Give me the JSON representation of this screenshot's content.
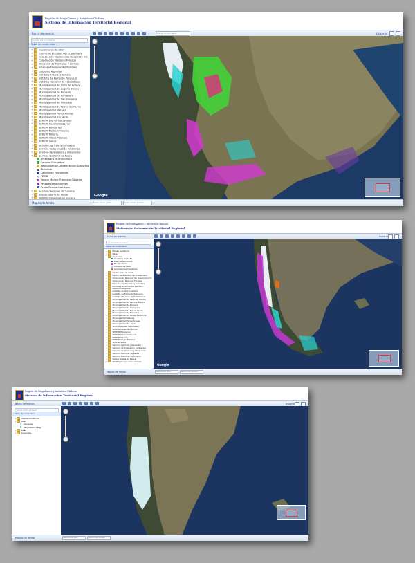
{
  "app": {
    "header_line1": "Región de Magallanes y Antártica Chilena",
    "header_line2": "Sistema de Información Territorial Regional"
  },
  "ui": {
    "panel_title": "Barra de menús",
    "search_placeholder": "Ingrese texto a buscar",
    "layers_tab": "Tabla de contenidos",
    "user_label": "Usuario",
    "status_label": "Mapas de fondo",
    "status_field1": "Seleccionar gobi",
    "status_field2": "Seleccionar ámbito",
    "map_credit": "Google",
    "search_box": "Buscar en el mapa..."
  },
  "screen1": {
    "layers": [
      {
        "label": "Carabineros de Chile",
        "kind": "folder"
      },
      {
        "label": "Centro de Estudios del Cuaternario",
        "kind": "folder"
      },
      {
        "label": "Corporación Nacional de Desarrollo Ind.",
        "kind": "folder"
      },
      {
        "label": "Corporación Nacional Forestal",
        "kind": "folder"
      },
      {
        "label": "Dirección de Fronteras y Límites",
        "kind": "folder"
      },
      {
        "label": "Empresa Nacional del Petróleo",
        "kind": "folder"
      },
      {
        "label": "Gobierno Regional",
        "kind": "folder"
      },
      {
        "label": "Instituto Antártico Chileno",
        "kind": "folder"
      },
      {
        "label": "Instituto de Fomento Pesquero",
        "kind": "folder"
      },
      {
        "label": "Instituto Nacional de Estadísticas",
        "kind": "folder"
      },
      {
        "label": "Municipalidad de Cabo de Hornos",
        "kind": "folder"
      },
      {
        "label": "Municipalidad de Laguna Blanca",
        "kind": "folder"
      },
      {
        "label": "Municipalidad de Porvenir",
        "kind": "folder"
      },
      {
        "label": "Municipalidad de Primavera",
        "kind": "folder"
      },
      {
        "label": "Municipalidad de San Gregorio",
        "kind": "folder"
      },
      {
        "label": "Municipalidad de Timaukel",
        "kind": "folder"
      },
      {
        "label": "Municipalidad de Torres del Payne",
        "kind": "folder"
      },
      {
        "label": "Municipalidad Natales",
        "kind": "folder"
      },
      {
        "label": "Municipalidad Punta Arenas",
        "kind": "folder"
      },
      {
        "label": "Municipalidad Río Verde",
        "kind": "folder"
      },
      {
        "label": "SEREMI Bienes Nacionales",
        "kind": "folder"
      },
      {
        "label": "SEREMI Desarrollo Social",
        "kind": "folder"
      },
      {
        "label": "SEREMI Educación",
        "kind": "folder"
      },
      {
        "label": "SEREMI Medio Ambiente",
        "kind": "folder"
      },
      {
        "label": "SEREMI Minería",
        "kind": "folder"
      },
      {
        "label": "SEREMI Obras Públicas",
        "kind": "folder"
      },
      {
        "label": "SEREMI Salud",
        "kind": "folder"
      },
      {
        "label": "Servicio Agrícola y Ganadero",
        "kind": "folder"
      },
      {
        "label": "Servicio de Evaluación Ambiental",
        "kind": "folder"
      },
      {
        "label": "Servicio de Vivienda y Urbanismo",
        "kind": "folder"
      },
      {
        "label": "Servicio Nacional de Pesca",
        "kind": "folder"
      },
      {
        "label": "Áreas para la Acuicultura",
        "kind": "layer",
        "color": "#3cb043"
      },
      {
        "label": "Centros Otorgados",
        "kind": "layer",
        "color": "#2a9d2a"
      },
      {
        "label": "Relocalización Desafectación Disturbio",
        "kind": "layer",
        "color": "#d9b300"
      },
      {
        "label": "Disturbio",
        "kind": "layer",
        "color": "#555555"
      },
      {
        "label": "Caletas de Pescadores",
        "kind": "layer",
        "color": "#1c2f8c"
      },
      {
        "label": "PDMB",
        "kind": "layer",
        "color": "#cccccc"
      },
      {
        "label": "Parque Marino Francisco Coloane",
        "kind": "layer",
        "color": "#c036c0"
      },
      {
        "label": "Pesca Recreativa Ríos",
        "kind": "layer",
        "color": "#7b2fbf"
      },
      {
        "label": "Pesca Recreativa Lagos",
        "kind": "layer",
        "color": "#2f5fbf"
      },
      {
        "label": "Servicio Nacional de Turismo",
        "kind": "folder"
      },
      {
        "label": "Subsecretaría de Pesca",
        "kind": "folder"
      },
      {
        "label": "Wildlife Conservation Society",
        "kind": "folder"
      }
    ]
  },
  "screen2": {
    "layers": [
      {
        "label": "Mapas temáticos",
        "kind": "folder"
      },
      {
        "label": "Base",
        "kind": "folder"
      },
      {
        "label": "Leyendas",
        "kind": "folder"
      },
      {
        "label": "Ciudades de Chile",
        "kind": "layer",
        "color": "#2a9d2a"
      },
      {
        "label": "Puertos Marítimos",
        "kind": "layer",
        "color": "#3b5bbf"
      },
      {
        "label": "Fondeaderos",
        "kind": "layer",
        "color": "#cc44cc"
      },
      {
        "label": "Campos de Hielo",
        "kind": "layer",
        "color": "#b0d8ff"
      },
      {
        "label": "Concesiones marítimas",
        "kind": "layer",
        "color": "#e06020"
      },
      {
        "label": "Carabineros de Chile",
        "kind": "folder"
      },
      {
        "label": "Centro de Estudios del Cuaternario",
        "kind": "folder"
      },
      {
        "label": "Corporación Nacional de Desarrollo Ind.",
        "kind": "folder"
      },
      {
        "label": "Corporación Nacional Forestal",
        "kind": "folder"
      },
      {
        "label": "Dirección de Fronteras y Límites",
        "kind": "folder"
      },
      {
        "label": "Empresa Nacional del Petróleo",
        "kind": "folder"
      },
      {
        "label": "Gobierno Regional",
        "kind": "folder"
      },
      {
        "label": "Instituto Antártico Chileno",
        "kind": "folder"
      },
      {
        "label": "Instituto de Fomento Pesquero",
        "kind": "folder"
      },
      {
        "label": "Instituto Nacional de Estadísticas",
        "kind": "folder"
      },
      {
        "label": "Municipalidad de Cabo de Hornos",
        "kind": "folder"
      },
      {
        "label": "Municipalidad de Laguna Blanca",
        "kind": "folder"
      },
      {
        "label": "Municipalidad de Porvenir",
        "kind": "folder"
      },
      {
        "label": "Municipalidad de Primavera",
        "kind": "folder"
      },
      {
        "label": "Municipalidad de San Gregorio",
        "kind": "folder"
      },
      {
        "label": "Municipalidad de Timaukel",
        "kind": "folder"
      },
      {
        "label": "Municipalidad de Torres del Payne",
        "kind": "folder"
      },
      {
        "label": "Municipalidad Natales",
        "kind": "folder"
      },
      {
        "label": "Municipalidad Punta Arenas",
        "kind": "folder"
      },
      {
        "label": "Municipalidad Río Verde",
        "kind": "folder"
      },
      {
        "label": "SEREMI Bienes Nacionales",
        "kind": "folder"
      },
      {
        "label": "SEREMI Desarrollo Social",
        "kind": "folder"
      },
      {
        "label": "SEREMI Educación",
        "kind": "folder"
      },
      {
        "label": "SEREMI Medio Ambiente",
        "kind": "folder"
      },
      {
        "label": "SEREMI Minería",
        "kind": "folder"
      },
      {
        "label": "SEREMI Obras Públicas",
        "kind": "folder"
      },
      {
        "label": "SEREMI Salud",
        "kind": "folder"
      },
      {
        "label": "Servicio Agrícola y Ganadero",
        "kind": "folder"
      },
      {
        "label": "Servicio de Evaluación Ambiental",
        "kind": "folder"
      },
      {
        "label": "Servicio de Vivienda y Urbanismo",
        "kind": "folder"
      },
      {
        "label": "Servicio Nacional de Pesca",
        "kind": "folder"
      },
      {
        "label": "Servicio Nacional de Turismo",
        "kind": "folder"
      },
      {
        "label": "Subsecretaría de Pesca",
        "kind": "folder"
      },
      {
        "label": "Wildlife Conservation Society",
        "kind": "folder"
      }
    ]
  },
  "screen3": {
    "layers": [
      {
        "label": "Mapas temáticos",
        "kind": "folder"
      },
      {
        "label": "Base",
        "kind": "folder"
      },
      {
        "label": "Glaciares",
        "kind": "layer",
        "color": "#b0d8ff"
      },
      {
        "label": "Ventisqueros Reg.",
        "kind": "layer",
        "color": "#8fc4f0"
      },
      {
        "label": "Base",
        "kind": "folder"
      },
      {
        "label": "Leyendas",
        "kind": "folder"
      }
    ]
  }
}
